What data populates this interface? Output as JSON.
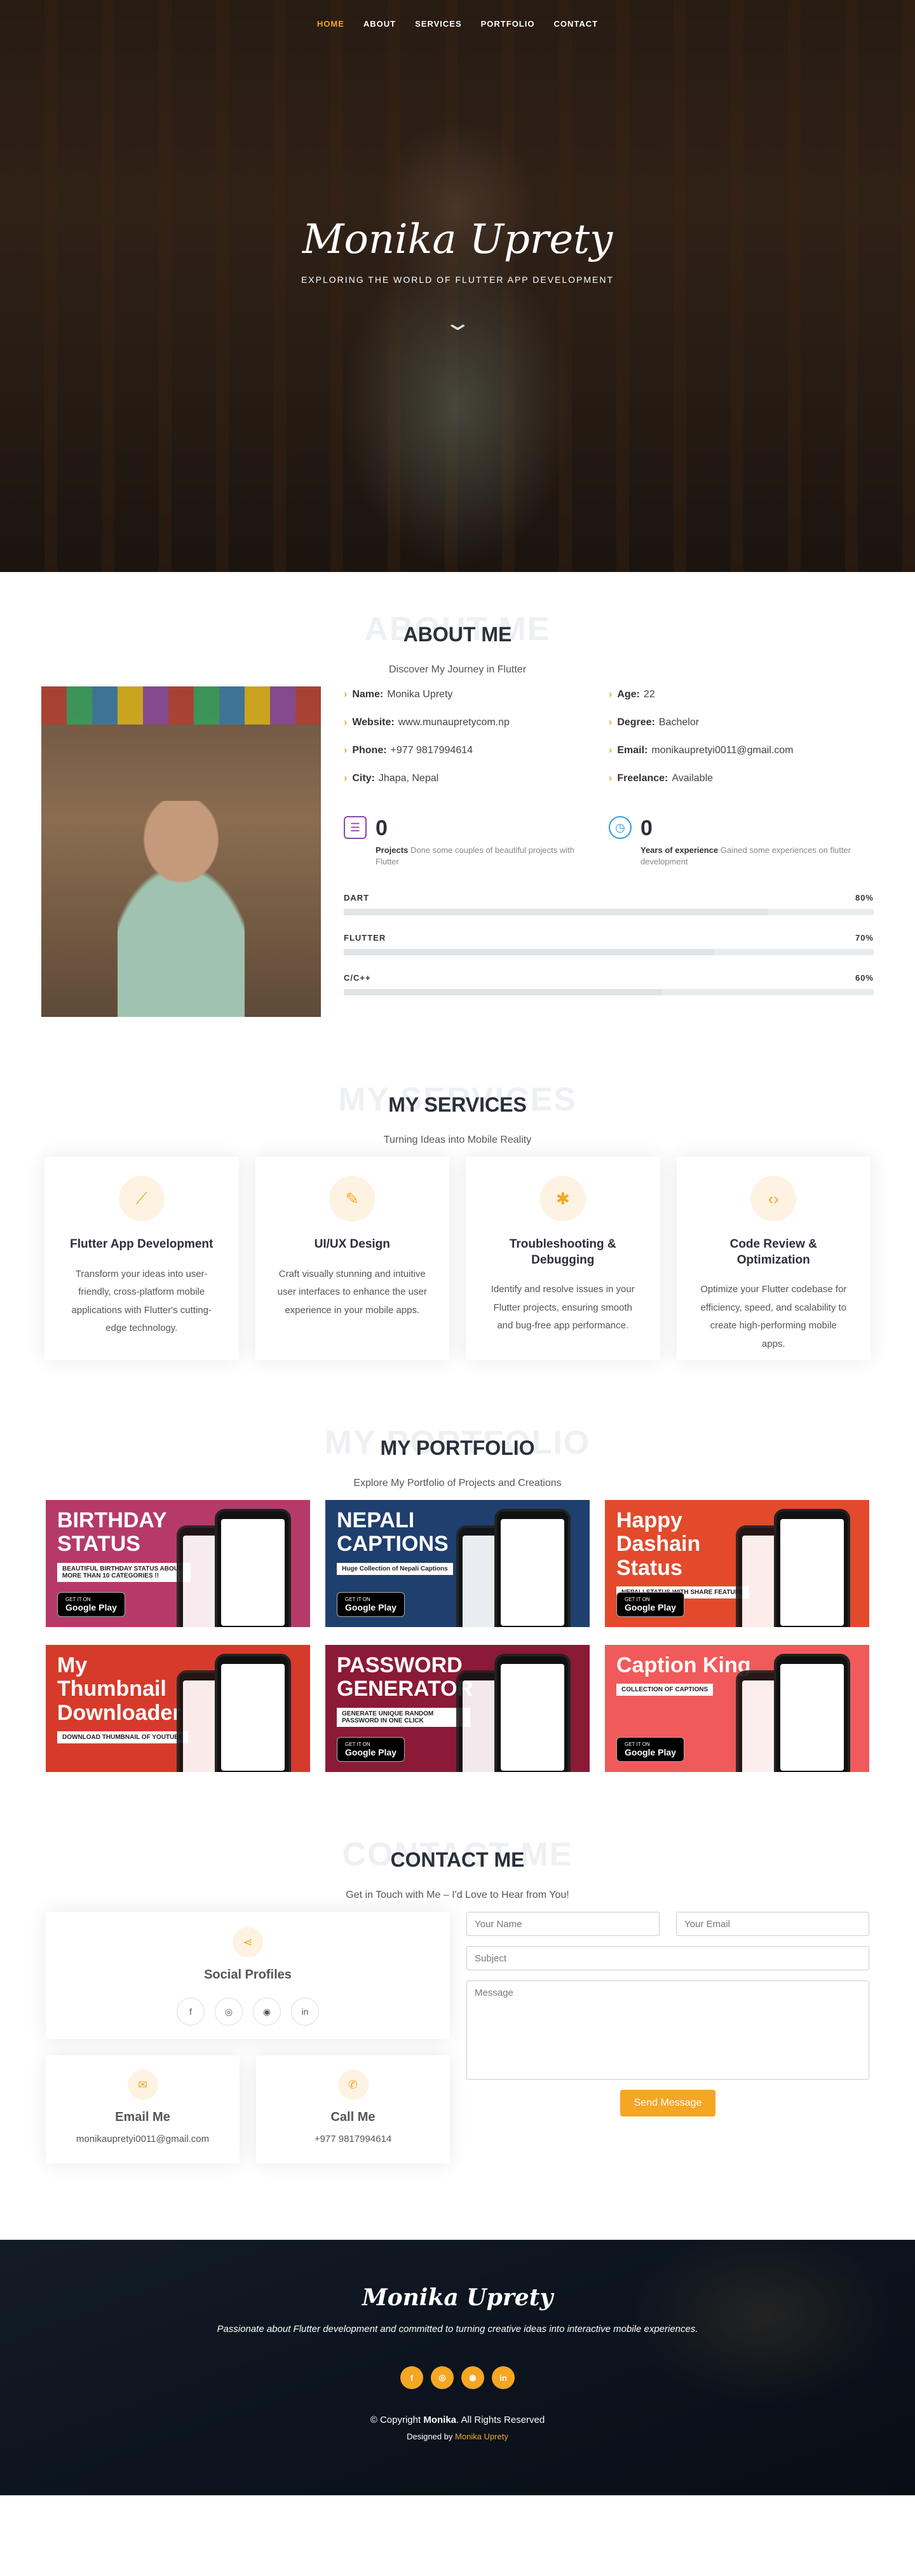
{
  "nav": [
    "HOME",
    "ABOUT",
    "SERVICES",
    "PORTFOLIO",
    "CONTACT"
  ],
  "hero": {
    "name": "Monika Uprety",
    "subtitle": "EXPLORING THE WORLD OF FLUTTER APP DEVELOPMENT",
    "scroll_icon": "chevron-down-icon"
  },
  "about": {
    "bg_title": "ABOUT ME",
    "title": "ABOUT ME",
    "subtitle": "Discover My Journey in Flutter",
    "info": [
      {
        "label": "Name:",
        "value": "Monika Uprety"
      },
      {
        "label": "Age:",
        "value": "22"
      },
      {
        "label": "Website:",
        "value": "www.munaupretycom.np"
      },
      {
        "label": "Degree:",
        "value": "Bachelor"
      },
      {
        "label": "Phone:",
        "value": "+977 9817994614"
      },
      {
        "label": "Email:",
        "value": "monikaupretyi0011@gmail.com"
      },
      {
        "label": "City:",
        "value": "Jhapa, Nepal"
      },
      {
        "label": "Freelance:",
        "value": "Available"
      }
    ],
    "counts": [
      {
        "num": "0",
        "label": "Projects",
        "text": "Done some couples of beautiful projects with Flutter"
      },
      {
        "num": "0",
        "label": "Years of experience",
        "text": "Gained some experiences on flutter development"
      }
    ],
    "skills": [
      {
        "name": "DART",
        "pct": "80%",
        "value": 0.8
      },
      {
        "name": "FLUTTER",
        "pct": "70%",
        "value": 0.7
      },
      {
        "name": "C/C++",
        "pct": "60%",
        "value": 0.6
      }
    ]
  },
  "services": {
    "bg_title": "MY SERVICES",
    "title": "MY SERVICES",
    "subtitle": "Turning Ideas into Mobile Reality",
    "items": [
      {
        "icon": "flutter-icon",
        "title": "Flutter App Development",
        "desc": "Transform your ideas into user-friendly, cross-platform mobile applications with Flutter's cutting-edge technology."
      },
      {
        "icon": "pen-tool-icon",
        "title": "UI/UX Design",
        "desc": "Craft visually stunning and intuitive user interfaces to enhance the user experience in your mobile apps."
      },
      {
        "icon": "bug-icon",
        "title": "Troubleshooting & Debugging",
        "desc": "Identify and resolve issues in your Flutter projects, ensuring smooth and bug-free app performance."
      },
      {
        "icon": "code-icon",
        "title": "Code Review & Optimization",
        "desc": "Optimize your Flutter codebase for efficiency, speed, and scalability to create high-performing mobile apps."
      }
    ]
  },
  "portfolio": {
    "bg_title": "MY PORTFOLIO",
    "title": "MY PORTFOLIO",
    "subtitle": "Explore My Portfolio of Projects and Creations",
    "items": [
      {
        "title": "BIRTHDAY STATUS",
        "tag": "BEAUTIFUL BIRTHDAY STATUS ABOUT MORE THAN 10 CATEGORIES !!",
        "play": "Google Play",
        "play_small": "GET IT ON",
        "color": "#b53a6a"
      },
      {
        "title": "NEPALI CAPTIONS",
        "tag": "Huge Collection of Nepali Captions",
        "play": "Google Play",
        "play_small": "GET IT ON",
        "color": "#1f3f6e"
      },
      {
        "title": "Happy Dashain Status",
        "tag": "NEPALI STATUS WITH SHARE FEATURE",
        "play": "Google Play",
        "play_small": "GET IT ON",
        "color": "#e24a2b"
      },
      {
        "title": "My Thumbnail Downloader",
        "tag": "DOWNLOAD THUMBNAIL OF YOUTUBE",
        "play": "",
        "play_small": "",
        "color": "#d63a2b"
      },
      {
        "title": "PASSWORD GENERATOR",
        "tag": "GENERATE UNIQUE RANDOM PASSWORD IN ONE CLICK",
        "play": "Google Play",
        "play_small": "GET IT ON",
        "color": "#8b1a36"
      },
      {
        "title": "Caption King",
        "tag": "COLLECTION OF CAPTIONS",
        "play": "Google Play",
        "play_small": "GET IT ON",
        "color": "#f05a5a"
      }
    ]
  },
  "contact": {
    "bg_title": "CONTACT ME",
    "title": "CONTACT ME",
    "subtitle": "Get in Touch with Me – I'd Love to Hear from You!",
    "social_title": "Social Profiles",
    "socials": [
      "facebook-icon",
      "instagram-icon",
      "github-icon",
      "linkedin-icon"
    ],
    "email_title": "Email Me",
    "email": "monikaupretyi0011@gmail.com",
    "call_title": "Call Me",
    "phone": "+977 9817994614",
    "form": {
      "name": "Your Name",
      "email": "Your Email",
      "subject": "Subject",
      "message": "Message",
      "button": "Send Message"
    }
  },
  "footer": {
    "name": "Monika Uprety",
    "desc": "Passionate about Flutter development and committed to turning creative ideas into interactive mobile experiences.",
    "copy_prefix": "© Copyright",
    "copy_name": "Monika",
    "copy_suffix": ". All Rights Reserved",
    "design_prefix": "Designed by",
    "design_name": "Monika Uprety"
  },
  "colors": {
    "accent": "#f5a623"
  }
}
